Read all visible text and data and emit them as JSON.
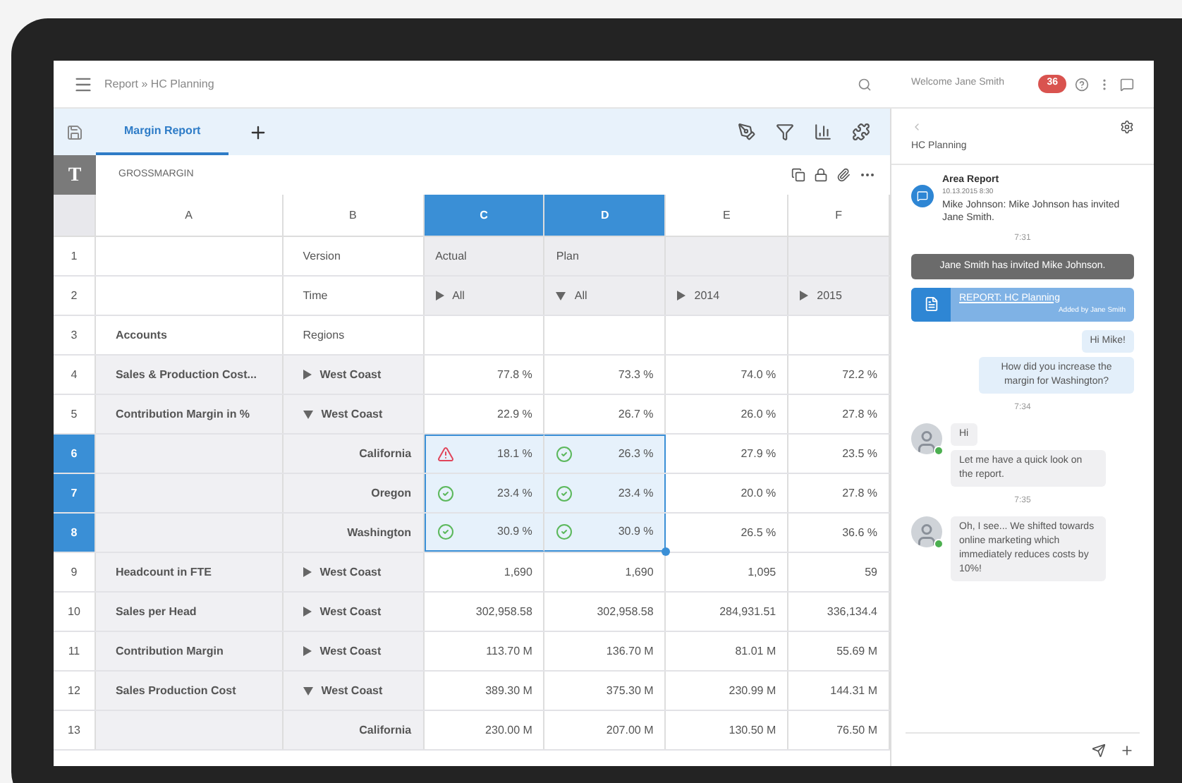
{
  "top_bar": {
    "breadcrumb": "Report » HC Planning",
    "welcome": "Welcome Jane Smith",
    "badge": "36"
  },
  "tabs": [
    {
      "label": "Margin Report",
      "selected": true
    }
  ],
  "sheet": {
    "type_letter": "T",
    "name": "GROSSMARGIN"
  },
  "grid": {
    "columns": [
      {
        "label": "A",
        "selected": false
      },
      {
        "label": "B",
        "selected": false
      },
      {
        "label": "C",
        "selected": true
      },
      {
        "label": "D",
        "selected": true
      },
      {
        "label": "E",
        "selected": false
      },
      {
        "label": "F",
        "selected": false
      }
    ],
    "rows": [
      {
        "label": "1",
        "kind": "header",
        "selected": false,
        "region": {
          "text": "Version"
        },
        "values": [
          {
            "text": "Actual"
          },
          {
            "text": "Plan"
          }
        ]
      },
      {
        "label": "2",
        "kind": "header",
        "selected": false,
        "region": {
          "text": "Time"
        },
        "values": [
          {
            "text": "All",
            "expanded": false
          },
          {
            "text": "All",
            "expanded": true
          },
          {
            "text": "2014",
            "expanded": false
          },
          {
            "text": "2015",
            "expanded": false
          }
        ]
      },
      {
        "label": "3",
        "kind": "title",
        "selected": false,
        "account": "Accounts",
        "region": {
          "text": "Regions"
        }
      },
      {
        "label": "4",
        "kind": "data",
        "selected": false,
        "account": "Sales & Production Cost...",
        "region": {
          "text": "West Coast",
          "expanded": false
        },
        "values": [
          {
            "text": "77.8 %"
          },
          {
            "text": "73.3 %"
          },
          {
            "text": "74.0 %"
          },
          {
            "text": "72.2 %"
          }
        ]
      },
      {
        "label": "5",
        "kind": "data",
        "selected": false,
        "account": "Contribution Margin in  %",
        "region": {
          "text": "West Coast",
          "expanded": true
        },
        "values": [
          {
            "text": "22.9 %"
          },
          {
            "text": "26.7 %"
          },
          {
            "text": "26.0 %"
          },
          {
            "text": "27.8 %"
          }
        ]
      },
      {
        "label": "6",
        "kind": "data",
        "selected": true,
        "region": {
          "text": "California"
        },
        "values": [
          {
            "text": "18.1 %",
            "warning": true
          },
          {
            "text": "26.3 %",
            "warning": false
          },
          {
            "text": "27.9 %"
          },
          {
            "text": "23.5 %"
          }
        ]
      },
      {
        "label": "7",
        "kind": "data",
        "selected": true,
        "region": {
          "text": "Oregon"
        },
        "values": [
          {
            "text": "23.4 %",
            "warning": false
          },
          {
            "text": "23.4 %",
            "warning": false
          },
          {
            "text": "20.0 %"
          },
          {
            "text": "27.8 %"
          }
        ]
      },
      {
        "label": "8",
        "kind": "data",
        "selected": true,
        "region": {
          "text": "Washington"
        },
        "values": [
          {
            "text": "30.9 %",
            "warning": false
          },
          {
            "text": "30.9 %",
            "warning": false
          },
          {
            "text": "26.5 %"
          },
          {
            "text": "36.6 %"
          }
        ]
      },
      {
        "label": "9",
        "kind": "data",
        "selected": false,
        "account": "Headcount in FTE",
        "region": {
          "text": "West Coast",
          "expanded": false
        },
        "values": [
          {
            "text": "1,690"
          },
          {
            "text": "1,690"
          },
          {
            "text": "1,095"
          },
          {
            "text": "59"
          }
        ]
      },
      {
        "label": "10",
        "kind": "data",
        "selected": false,
        "account": "Sales per Head",
        "region": {
          "text": "West Coast",
          "expanded": false
        },
        "values": [
          {
            "text": "302,958.58"
          },
          {
            "text": "302,958.58"
          },
          {
            "text": "284,931.51"
          },
          {
            "text": "336,134.4"
          }
        ]
      },
      {
        "label": "11",
        "kind": "data",
        "selected": false,
        "account": "Contribution Margin",
        "region": {
          "text": "West Coast",
          "expanded": false
        },
        "values": [
          {
            "text": "113.70 M"
          },
          {
            "text": "136.70 M"
          },
          {
            "text": "81.01 M"
          },
          {
            "text": "55.69 M"
          }
        ]
      },
      {
        "label": "12",
        "kind": "data",
        "selected": false,
        "account": "Sales Production Cost",
        "region": {
          "text": "West Coast",
          "expanded": true
        },
        "values": [
          {
            "text": "389.30 M"
          },
          {
            "text": "375.30 M"
          },
          {
            "text": "230.99 M"
          },
          {
            "text": "144.31 M"
          }
        ]
      },
      {
        "label": "13",
        "kind": "data",
        "selected": false,
        "region": {
          "text": "California"
        },
        "values": [
          {
            "text": "230.00 M"
          },
          {
            "text": "207.00 M"
          },
          {
            "text": "130.50 M"
          },
          {
            "text": "76.50 M"
          }
        ]
      }
    ]
  },
  "chat": {
    "title": "HC Planning",
    "messages": [
      {
        "kind": "notification",
        "title": "Area Report",
        "date": "10.13.2015 8:30",
        "text": "Mike Johnson: Mike Johnson has invited Jane Smith."
      },
      {
        "kind": "time",
        "text": "7:31"
      },
      {
        "kind": "system",
        "text": "Jane Smith has invited Mike Johnson."
      },
      {
        "kind": "link",
        "title": "REPORT: HC Planning",
        "subtitle": "Added by Jane Smith"
      },
      {
        "kind": "outgoing",
        "lines": [
          "Hi Mike!",
          "How did you increase the margin for Washington?"
        ]
      },
      {
        "kind": "time",
        "text": "7:34"
      },
      {
        "kind": "incoming",
        "online": true,
        "lines": [
          "Hi",
          "Let me have a quick look on the report."
        ]
      },
      {
        "kind": "time",
        "text": "7:35"
      },
      {
        "kind": "incoming",
        "online": true,
        "lines": [
          "Oh, I see... We shifted towards online marketing which immediately reduces costs by 10%!"
        ]
      }
    ]
  }
}
